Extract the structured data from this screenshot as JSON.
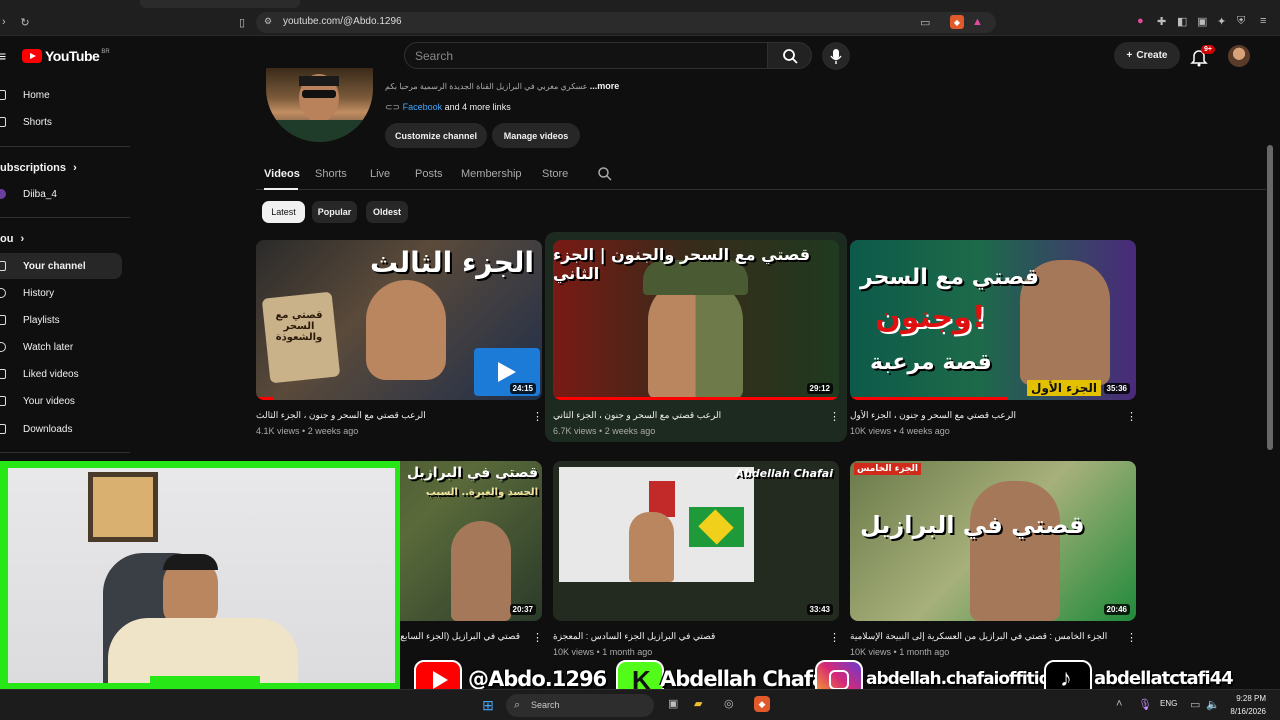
{
  "browser": {
    "url": "youtube.com/@Abdo.1296"
  },
  "header": {
    "logo_text": "YouTube",
    "region_code": "BR",
    "search_placeholder": "Search",
    "create_label": "Create",
    "notification_badge": "9+"
  },
  "sidebar": {
    "top_items": [
      {
        "label": "Home",
        "icon": "home-icon"
      },
      {
        "label": "Shorts",
        "icon": "shorts-icon"
      }
    ],
    "subscriptions_heading": "ubscriptions",
    "subscriptions": [
      {
        "label": "Diiba_4"
      }
    ],
    "you_heading": "ou",
    "you_items": [
      {
        "label": "Your channel",
        "active": true
      },
      {
        "label": "History"
      },
      {
        "label": "Playlists"
      },
      {
        "label": "Watch later"
      },
      {
        "label": "Liked videos"
      },
      {
        "label": "Your videos"
      },
      {
        "label": "Downloads"
      }
    ]
  },
  "channel": {
    "description": "عسكري مغربي في البرازيل القناة الجديدة الرسمية مرحبا بكم",
    "more_label": "...more",
    "links_primary": "Facebook",
    "links_more": "and 4 more links",
    "customize_label": "Customize channel",
    "manage_label": "Manage videos"
  },
  "tabs": [
    "Videos",
    "Shorts",
    "Live",
    "Posts",
    "Membership",
    "Store"
  ],
  "chips": [
    "Latest",
    "Popular",
    "Oldest"
  ],
  "videos": [
    {
      "title": "الرعب قصتي مع السحر و جنون ، الجزء الثالث",
      "views": "4.1K views",
      "age": "2 weeks ago",
      "duration": "24:15",
      "thumb_text": "الجزء الثالث",
      "thumb_sub": "قصتي مع السحر والشعوذة",
      "progress": 0.06
    },
    {
      "title": "الرعب قصتي مع السحر و جنون ، الجزء الثاني",
      "views": "6.7K views",
      "age": "2 weeks ago",
      "duration": "29:12",
      "thumb_text": "قصتي مع السحر والجنون | الجزء الثاني",
      "thumb_sub": "",
      "progress": 1.0
    },
    {
      "title": "الرعب قصتي مع السحر و جنون ، الجزء الأول",
      "views": "10K views",
      "age": "4 weeks ago",
      "duration": "35:36",
      "thumb_text": "قصتي مع السحر",
      "thumb_sub": "وجنون!",
      "thumb_sub2": "قصة مرعبة",
      "thumb_badge": "الجزء الأول",
      "progress": 0.55
    },
    {
      "title": "قصتي في البرازيل (الجزء السابع )",
      "views": "",
      "age": "",
      "duration": "20:37",
      "thumb_text": "قصتي في البرازيل",
      "thumb_sub": "الحسد والغيرة.. السبب",
      "progress": 0
    },
    {
      "title": "قصتي في البرازيل الجزء السادس : المعجزة",
      "views": "10K views",
      "age": "1 month ago",
      "duration": "33:43",
      "thumb_text": "Abdellah Chafai",
      "thumb_sub": "",
      "progress": 0
    },
    {
      "title": "الجزء الخامس : قصتي في البرازيل من العسكرية إلى النبيحة الإسلامية",
      "views": "10K views",
      "age": "1 month ago",
      "duration": "20:46",
      "thumb_text": "قصتي في البرازيل",
      "thumb_sub": "الجزء الخامس",
      "progress": 0
    }
  ],
  "social_banner": [
    {
      "icon": "youtube-icon",
      "text": "@Abdo.1296"
    },
    {
      "icon": "kick-icon",
      "text": "Abdellah Chafai"
    },
    {
      "icon": "instagram-icon",
      "text": "abdellah.chafaioffitid"
    },
    {
      "icon": "tiktok-icon",
      "text": "abdellatctafi44"
    }
  ],
  "taskbar": {
    "search_label": "Search",
    "language": "ENG",
    "time": "9:28 PM",
    "date": "8/16/2026"
  },
  "colors": {
    "background": "#0f0f0f",
    "accent_red": "#ff0000",
    "link_blue": "#3ea6ff",
    "webcam_border": "#27e816"
  }
}
